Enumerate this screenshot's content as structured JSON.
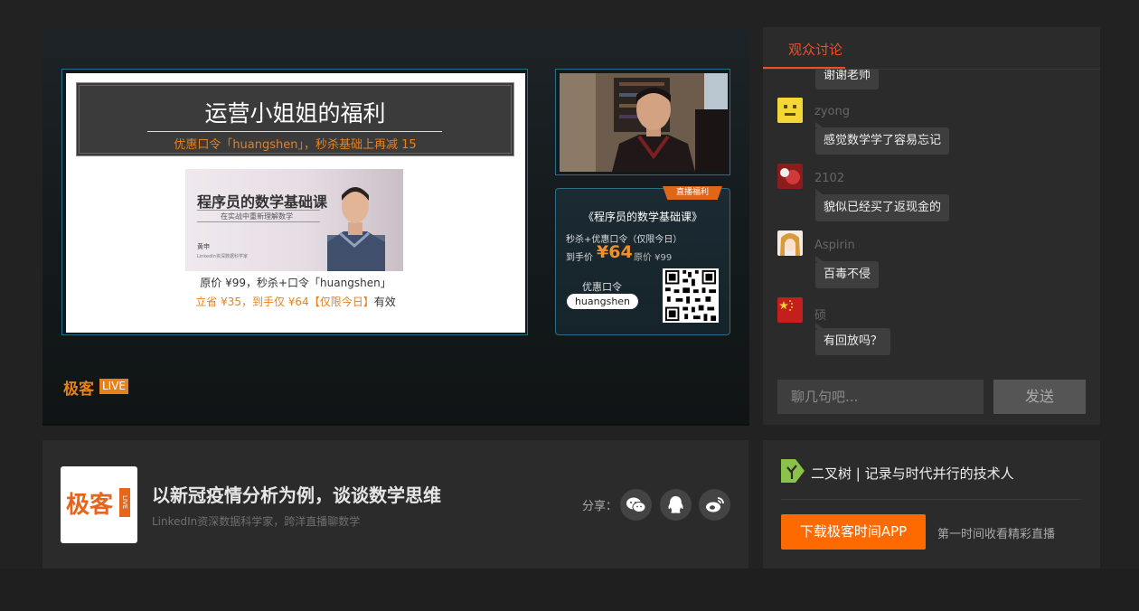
{
  "player": {
    "slide": {
      "title": "运营小姐姐的福利",
      "coupon_line": "优惠口令「huangshen」，秒杀基础上再减 15",
      "book_title": "程序员的数学基础课",
      "book_subtitle": "在实战中重新理解数学",
      "book_author": "黄申",
      "book_author_desc": "LinkedIn资深数据科学家",
      "price_line1": "原价 ¥99，秒杀+口令「huangshen」",
      "price_line2_orange": "立省 ¥35，到手仅 ¥64【仅限今日】",
      "price_line2_black": "有效"
    },
    "promo": {
      "tag": "直播福利",
      "title": "《程序员的数学基础课》",
      "line1": "秒杀+优惠口令（仅限今日）",
      "final_label": "到手价",
      "final_price": "¥64",
      "original": "原价 ¥99",
      "code_label": "优惠口令",
      "code": "huangshen"
    },
    "brand": {
      "name": "极客",
      "live": "LIVE"
    }
  },
  "info": {
    "logo_text": "极客",
    "logo_live": "LIVE",
    "title": "以新冠疫情分析为例，谈谈数学思维",
    "subtitle": "LinkedIn资深数据科学家，跨洋直播聊数学",
    "share_label": "分享：",
    "share_icons": [
      "wechat-icon",
      "qq-icon",
      "weibo-icon"
    ]
  },
  "chat": {
    "tab": "观众讨论",
    "messages": [
      {
        "user": "",
        "text": "谢谢老师",
        "avatar": "hidden"
      },
      {
        "user": "zyong",
        "text": "感觉数学学了容易忘记",
        "avatar": "yellow-emoji"
      },
      {
        "user": "2102",
        "text": "貌似已经买了返现金的",
        "avatar": "red-photo"
      },
      {
        "user": "Aspirin",
        "text": "百毒不侵",
        "avatar": "anime-girl"
      },
      {
        "user": "硕",
        "text": "有回放吗？",
        "avatar": "china-flag"
      }
    ],
    "input_placeholder": "聊几句吧...",
    "send_label": "发送"
  },
  "app": {
    "title": "二叉树 | 记录与时代并行的技术人",
    "download_label": "下载极客时间APP",
    "note": "第一时间收看精彩直播"
  },
  "colors": {
    "accent": "#e6532a",
    "orange": "#e6821e",
    "download": "#ff6a00",
    "panel": "#2b2b2b",
    "page": "#222222"
  }
}
